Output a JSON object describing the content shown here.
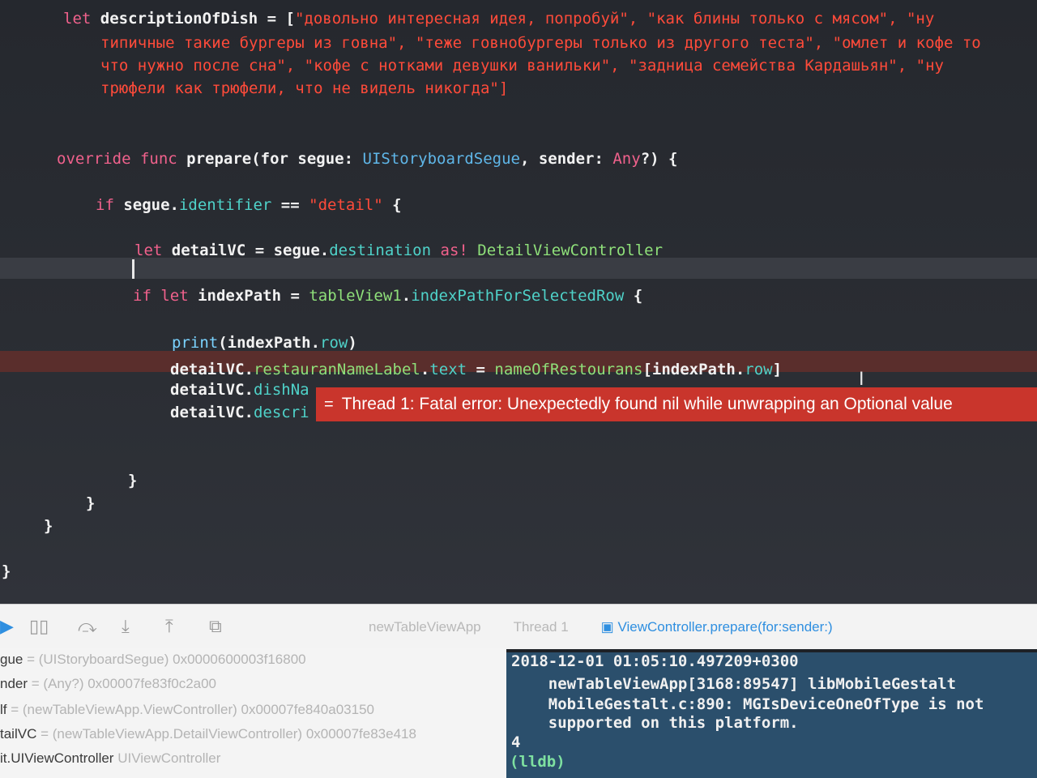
{
  "editor": {
    "lines": [
      {
        "id": "l1",
        "segs": [
          [
            "kw",
            "let "
          ],
          [
            "plain",
            "descriptionOfDish = ["
          ],
          [
            "str",
            "\"довольно интересная идея, попробуй\", \"как блины только с мясом\", \"ну"
          ]
        ]
      },
      {
        "id": "l2",
        "segs": [
          [
            "str",
            "типичные такие бургеры из говна\", \"теже говнобургеры только из другого теста\", \"омлет и кофе то"
          ]
        ]
      },
      {
        "id": "l3",
        "segs": [
          [
            "str",
            "что нужно после сна\", \"кофе с нотками девушки ванильки\", \"задница семейства Кардашьян\", \"ну"
          ]
        ]
      },
      {
        "id": "l4",
        "segs": [
          [
            "str",
            "трюфели как трюфели, что не видель никогда\"]"
          ]
        ]
      },
      {
        "id": "l5",
        "segs": [
          [
            "kw",
            "override func "
          ],
          [
            "plain",
            "prepare(for segue: "
          ],
          [
            "type",
            "UIStoryboardSegue"
          ],
          [
            "plain",
            ", sender: "
          ],
          [
            "kw",
            "Any"
          ],
          [
            "plain",
            "?) {"
          ]
        ]
      },
      {
        "id": "l6",
        "segs": [
          [
            "kw",
            "if "
          ],
          [
            "plain",
            "segue."
          ],
          [
            "mem",
            "identifier"
          ],
          [
            "plain",
            " == "
          ],
          [
            "str",
            "\"detail\""
          ],
          [
            "plain",
            " {"
          ]
        ]
      },
      {
        "id": "l7",
        "segs": [
          [
            "kw",
            "let "
          ],
          [
            "plain",
            "detailVC = segue."
          ],
          [
            "mem",
            "destination"
          ],
          [
            "kw",
            " as! "
          ],
          [
            "tyg",
            "DetailViewController"
          ]
        ]
      },
      {
        "id": "l8",
        "segs": [
          [
            "kw",
            "if let "
          ],
          [
            "plain",
            "indexPath = "
          ],
          [
            "tyg",
            "tableView1"
          ],
          [
            "plain",
            "."
          ],
          [
            "mem",
            "indexPathForSelectedRow"
          ],
          [
            "plain",
            " {"
          ]
        ]
      },
      {
        "id": "l9",
        "segs": [
          [
            "fn",
            "print"
          ],
          [
            "plain",
            "(indexPath."
          ],
          [
            "mem",
            "row"
          ],
          [
            "plain",
            ")"
          ]
        ]
      },
      {
        "id": "l10",
        "segs": [
          [
            "plain",
            "detailVC."
          ],
          [
            "tyg",
            "restauranNameLabel"
          ],
          [
            "plain",
            "."
          ],
          [
            "mem",
            "text"
          ],
          [
            "plain",
            " = "
          ],
          [
            "tyg",
            "nameOfRestourans"
          ],
          [
            "plain",
            "[indexPath."
          ],
          [
            "mem",
            "row"
          ],
          [
            "plain",
            "]"
          ]
        ]
      },
      {
        "id": "l11",
        "segs": [
          [
            "plain",
            "detailVC."
          ],
          [
            "mem",
            "dishNa"
          ]
        ]
      },
      {
        "id": "l12",
        "segs": [
          [
            "plain",
            "detailVC."
          ],
          [
            "mem",
            "descri"
          ]
        ]
      },
      {
        "id": "l13",
        "segs": [
          [
            "plain",
            "}"
          ]
        ]
      },
      {
        "id": "l14",
        "segs": [
          [
            "plain",
            "}"
          ]
        ]
      },
      {
        "id": "l15",
        "segs": [
          [
            "plain",
            "}"
          ]
        ]
      },
      {
        "id": "l16",
        "segs": [
          [
            "plain",
            "}"
          ]
        ]
      }
    ]
  },
  "error": {
    "icon": "=",
    "message": "Thread 1: Fatal error: Unexpectedly found nil while unwrapping an Optional value"
  },
  "debug_bar": {
    "crumbs": [
      "newTableViewApp",
      "Thread 1",
      "ViewController.prepare(for:sender:)"
    ]
  },
  "variables": [
    {
      "name": "gue",
      "value": " = (UIStoryboardSegue) 0x0000600003f16800"
    },
    {
      "name": "nder",
      "value": " = (Any?) 0x00007fe83f0c2a00"
    },
    {
      "name": "lf",
      "value": " = (newTableViewApp.ViewController) 0x00007fe840a03150"
    },
    {
      "name": "tailVC",
      "value": " = (newTableViewApp.DetailViewController) 0x00007fe83e418"
    },
    {
      "name": "it.UIViewController",
      "value": " UIViewController"
    }
  ],
  "console": {
    "lines": [
      "2018-12-01 01:05:10.497209+0300",
      "    newTableViewApp[3168:89547] libMobileGestalt",
      "    MobileGestalt.c:890: MGIsDeviceOneOfType is not",
      "    supported on this platform.",
      "4"
    ],
    "prompt": "(lldb)"
  },
  "colors": {
    "error_banner": "#c9352c",
    "console_bg": "#2b4f6c",
    "editor_bg": "#25282e"
  }
}
